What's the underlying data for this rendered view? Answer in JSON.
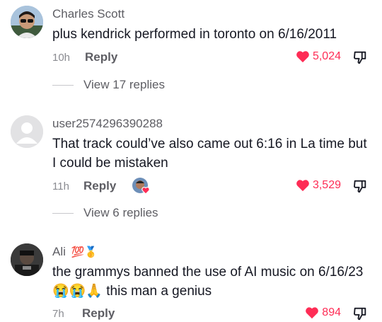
{
  "comments": [
    {
      "username": "Charles Scott",
      "text": "plus kendrick performed in toronto on 6/16/2011",
      "time": "10h",
      "reply_label": "Reply",
      "likes": "5,024",
      "view_replies": "View 17 replies"
    },
    {
      "username": "user2574296390288",
      "text": "That track could’ve also came out 6:16 in La time but I could be mistaken",
      "time": "11h",
      "reply_label": "Reply",
      "likes": "3,529",
      "view_replies": "View 6 replies"
    },
    {
      "username": "Ali",
      "username_emoji": "💯🥇",
      "text": "the grammys banned the use of AI music on 6/16/23 😭😭🙏 this man a genius",
      "time": "7h",
      "reply_label": "Reply",
      "likes": "894"
    }
  ],
  "colors": {
    "like_red": "#fe2c55",
    "secondary_text": "#5d5d63",
    "primary_text": "#161823"
  },
  "icons": [
    "heart-icon",
    "dislike-icon",
    "liked-by-creator-icon"
  ]
}
